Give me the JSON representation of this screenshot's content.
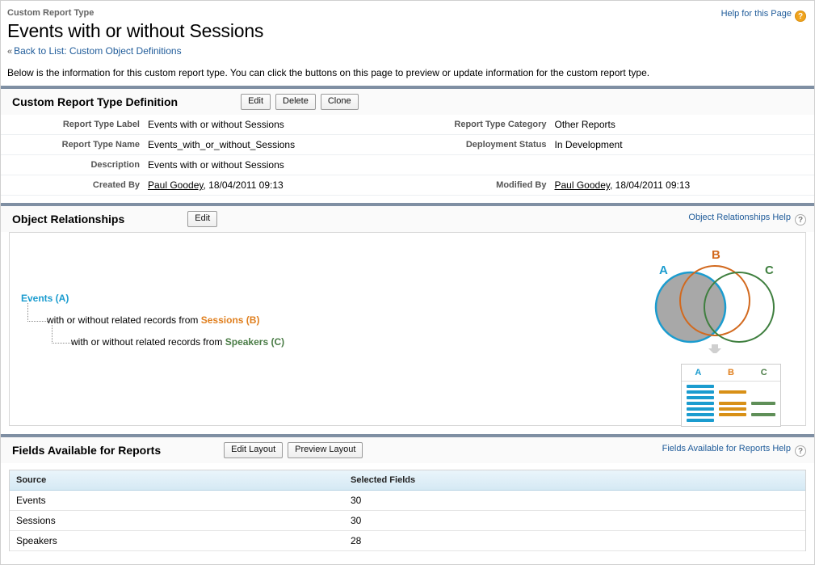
{
  "header": {
    "eyebrow": "Custom Report Type",
    "title": "Events with or without Sessions",
    "back_chevron": "«",
    "back_prefix": "Back to List:",
    "back_target": "Custom Object Definitions",
    "help_label": "Help for this Page",
    "help_icon": "question-mark-icon"
  },
  "intro": "Below is the information for this custom report type. You can click the buttons on this page to preview or update information for the custom report type.",
  "definition": {
    "title": "Custom Report Type Definition",
    "buttons": [
      "Edit",
      "Delete",
      "Clone"
    ],
    "rows": [
      {
        "left_label": "Report Type Label",
        "left_value": "Events with or without Sessions",
        "right_label": "Report Type Category",
        "right_value": "Other Reports"
      },
      {
        "left_label": "Report Type Name",
        "left_value": "Events_with_or_without_Sessions",
        "right_label": "Deployment Status",
        "right_value": "In Development"
      },
      {
        "left_label": "Description",
        "left_value": "Events with or without Sessions",
        "right_label": "",
        "right_value": ""
      },
      {
        "left_label": "Created By",
        "left_value": "Paul Goodey, 18/04/2011 09:13",
        "left_link": "Paul Goodey",
        "right_label": "Modified By",
        "right_value": "Paul Goodey, 18/04/2011 09:13",
        "right_link": "Paul Goodey"
      }
    ]
  },
  "object_relationships": {
    "title": "Object Relationships",
    "edit_button": "Edit",
    "help_label": "Object Relationships Help",
    "tree": [
      {
        "object": "Events (A)",
        "prefix": ""
      },
      {
        "prefix": "with or without related records from ",
        "object": "Sessions (B)"
      },
      {
        "prefix": "with or without related records from ",
        "object": "Speakers (C)"
      }
    ],
    "venn": {
      "labels": [
        "A",
        "B",
        "C"
      ],
      "colors": {
        "a": "#1b9ccf",
        "b": "#d2691e",
        "c": "#3f7f3f",
        "fill_a": "#a8a8a8"
      }
    },
    "legend": {
      "columns": [
        "A",
        "B",
        "C"
      ],
      "colors": {
        "a": "#1b9ccf",
        "b": "#d89016",
        "c": "#5f8f58"
      },
      "bar_counts": {
        "a": 7,
        "b": 4,
        "c": 2
      }
    }
  },
  "fields_available": {
    "title": "Fields Available for Reports",
    "buttons": [
      "Edit Layout",
      "Preview Layout"
    ],
    "help_label": "Fields Available for Reports Help",
    "columns": [
      "Source",
      "Selected Fields"
    ],
    "rows": [
      {
        "source": "Events",
        "selected": "30"
      },
      {
        "source": "Sessions",
        "selected": "30"
      },
      {
        "source": "Speakers",
        "selected": "28"
      }
    ]
  }
}
